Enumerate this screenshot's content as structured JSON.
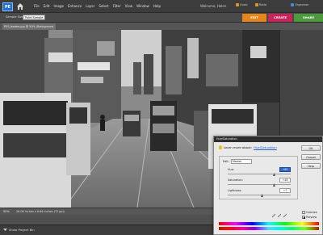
{
  "app": {
    "logo_text": "PE",
    "menu": [
      "File",
      "Edit",
      "Image",
      "Enhance",
      "Layer",
      "Select",
      "Filter",
      "View",
      "Window",
      "Help"
    ],
    "welcome_text": "Welcome, Helen",
    "top_buttons": [
      {
        "label": "Undo",
        "color": "#d99a2b"
      },
      {
        "label": "Redo",
        "color": "#d99a2b"
      },
      {
        "label": "Organizer",
        "color": "#3b8fd6"
      }
    ]
  },
  "options": {
    "sample_size_label": "Sample Size:",
    "sample_size_value": "Point Sample"
  },
  "modes": [
    {
      "label": "EDIT",
      "color": "#e8841c"
    },
    {
      "label": "CREATE",
      "color": "#c9235a"
    },
    {
      "label": "SHARE",
      "color": "#4b9a3c"
    }
  ],
  "document": {
    "tab_label": "P50_bwdee.jpg @ 50% (Background, RGB/8)",
    "zoom": "50%",
    "doc_size": "26.06 inches x 8.66 inches (72 ppi)"
  },
  "bottom": {
    "show_bin_label": "Show Project Bin"
  },
  "dialog": {
    "title": "Hue/Saturation",
    "learn_prefix": "Learn more about:",
    "learn_link": "Hue/Saturation",
    "buttons": [
      "OK",
      "Cancel",
      "Help"
    ],
    "edit_label": "Edit:",
    "edit_value": "Master",
    "hue_label": "Hue:",
    "hue_value": "+65",
    "saturation_label": "Saturation:",
    "saturation_value": "+48",
    "lightness_label": "Lightness:",
    "lightness_value": "+7",
    "colorize_label": "Colorize",
    "preview_label": "Preview",
    "colorize_checked": false,
    "preview_checked": true
  }
}
